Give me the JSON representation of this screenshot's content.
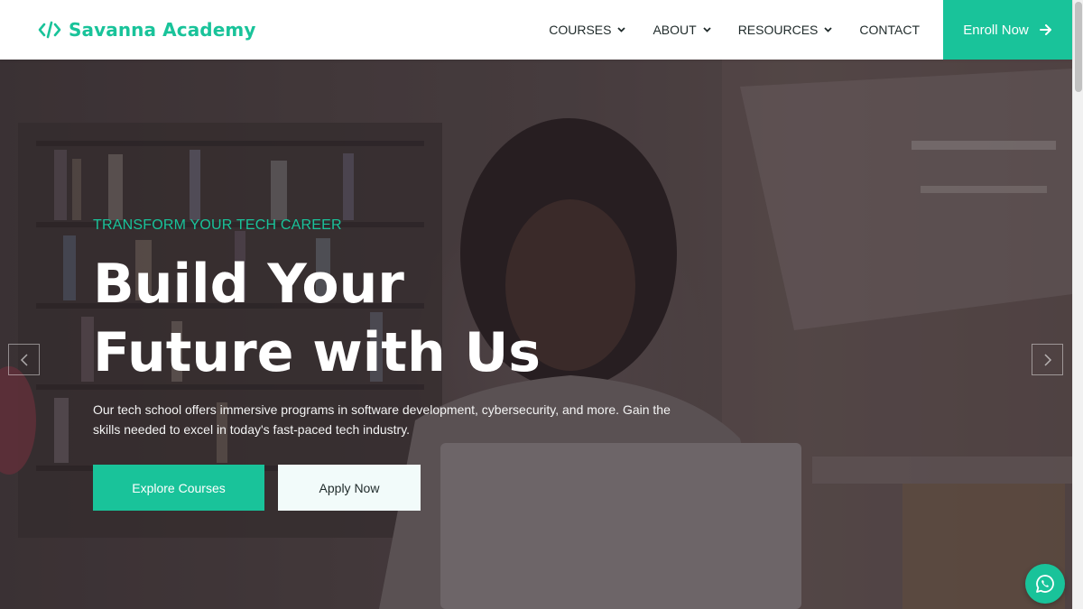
{
  "brand": {
    "name": "Savanna Academy",
    "icon": "code-icon"
  },
  "nav": {
    "items": [
      {
        "label": "COURSES",
        "has_dropdown": true
      },
      {
        "label": "ABOUT",
        "has_dropdown": true
      },
      {
        "label": "RESOURCES",
        "has_dropdown": true
      },
      {
        "label": "CONTACT",
        "has_dropdown": false
      }
    ],
    "cta": {
      "label": "Enroll Now",
      "icon": "arrow-right-icon"
    }
  },
  "hero": {
    "eyebrow": "TRANSFORM YOUR TECH CAREER",
    "title": "Build Your Future with Us",
    "description": "Our tech school offers immersive programs in software development, cybersecurity, and more. Gain the skills needed to excel in today's fast-paced tech industry.",
    "primary_button": "Explore Courses",
    "secondary_button": "Apply Now"
  },
  "carousel": {
    "prev_icon": "chevron-left-icon",
    "next_icon": "chevron-right-icon"
  },
  "floating": {
    "icon": "whatsapp-icon"
  },
  "colors": {
    "accent": "#19c39a",
    "text_dark": "#1f2a2a",
    "white": "#ffffff"
  }
}
